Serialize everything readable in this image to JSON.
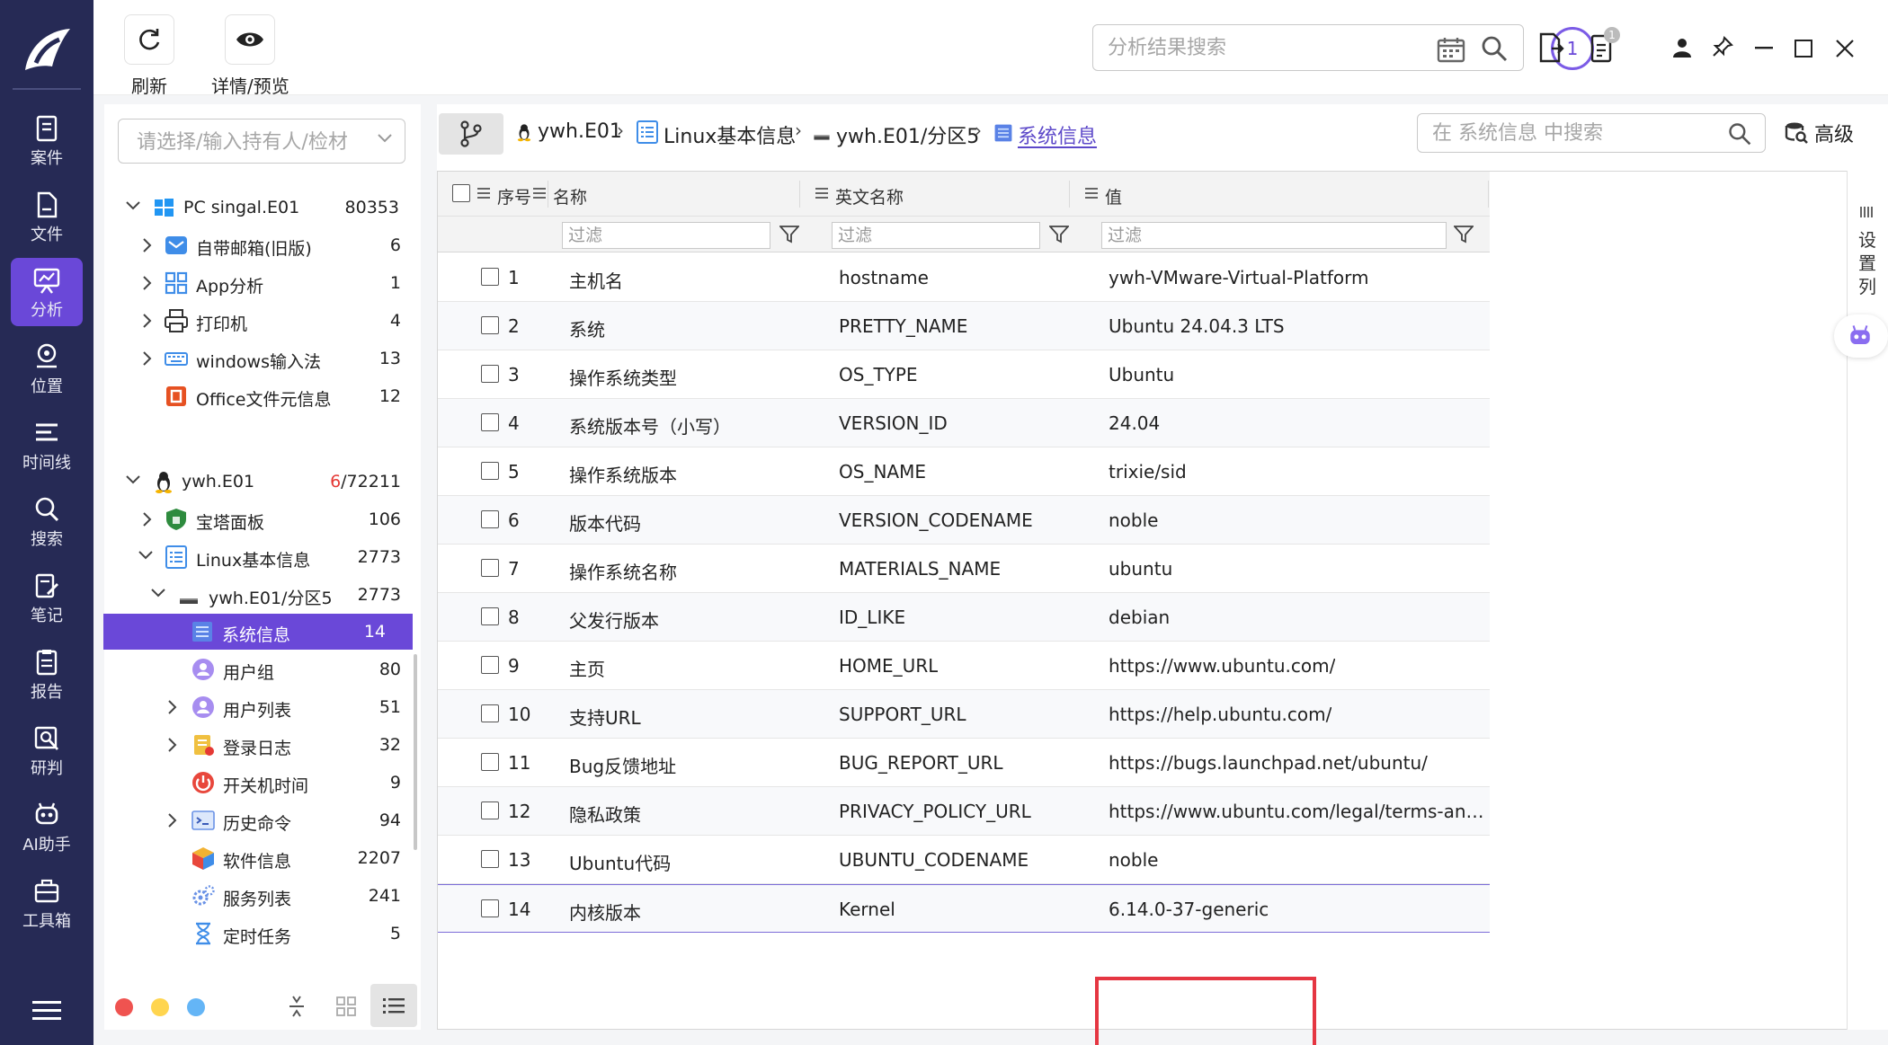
{
  "nav": {
    "items": [
      {
        "label": "案件",
        "icon": "case-icon"
      },
      {
        "label": "文件",
        "icon": "file-icon"
      },
      {
        "label": "分析",
        "icon": "analysis-icon"
      },
      {
        "label": "位置",
        "icon": "location-icon"
      },
      {
        "label": "时间线",
        "icon": "timeline-icon"
      },
      {
        "label": "搜索",
        "icon": "search-icon"
      },
      {
        "label": "笔记",
        "icon": "note-icon"
      },
      {
        "label": "报告",
        "icon": "report-icon"
      },
      {
        "label": "研判",
        "icon": "judge-icon"
      },
      {
        "label": "AI助手",
        "icon": "ai-robot-icon"
      },
      {
        "label": "工具箱",
        "icon": "toolbox-icon"
      }
    ],
    "active": "分析"
  },
  "toolbar": {
    "refresh_label": "刷新",
    "preview_label": "详情/预览",
    "search_placeholder": "分析结果搜索",
    "task_count": "1",
    "clipboard_badge": "1"
  },
  "tree": {
    "select_placeholder": "请选择/输入持有人/检材",
    "nodes": [
      {
        "label": "PC singal.E01",
        "count": "80353"
      },
      {
        "label": "自带邮箱(旧版)",
        "count": "6"
      },
      {
        "label": "App分析",
        "count": "1"
      },
      {
        "label": "打印机",
        "count": "4"
      },
      {
        "label": "windows输入法",
        "count": "13"
      },
      {
        "label": "Office文件元信息",
        "count": "12"
      },
      {
        "label": "ywh.E01",
        "count_red": "6",
        "count_rest": "/72211"
      },
      {
        "label": "宝塔面板",
        "count": "106"
      },
      {
        "label": "Linux基本信息",
        "count": "2773"
      },
      {
        "label": "ywh.E01/分区5",
        "count": "2773"
      },
      {
        "label": "系统信息",
        "count": "14"
      },
      {
        "label": "用户组",
        "count": "80"
      },
      {
        "label": "用户列表",
        "count": "51"
      },
      {
        "label": "登录日志",
        "count": "32"
      },
      {
        "label": "开关机时间",
        "count": "9"
      },
      {
        "label": "历史命令",
        "count": "94"
      },
      {
        "label": "软件信息",
        "count": "2207"
      },
      {
        "label": "服务列表",
        "count": "241"
      },
      {
        "label": "定时任务",
        "count": "5"
      }
    ]
  },
  "breadcrumb": {
    "items": [
      "ywh.E01",
      "Linux基本信息",
      "ywh.E01/分区5",
      "系统信息"
    ],
    "search_placeholder": "在 系统信息 中搜索",
    "advanced_label": "高级"
  },
  "table": {
    "headers": [
      "序号",
      "名称",
      "英文名称",
      "值"
    ],
    "filter_placeholder": "过滤",
    "rows": [
      {
        "no": "1",
        "name": "主机名",
        "en": "hostname",
        "value": "ywh-VMware-Virtual-Platform"
      },
      {
        "no": "2",
        "name": "系统",
        "en": "PRETTY_NAME",
        "value": "Ubuntu 24.04.3 LTS"
      },
      {
        "no": "3",
        "name": "操作系统类型",
        "en": "OS_TYPE",
        "value": "Ubuntu"
      },
      {
        "no": "4",
        "name": "系统版本号（小写）",
        "en": "VERSION_ID",
        "value": "24.04"
      },
      {
        "no": "5",
        "name": "操作系统版本",
        "en": "OS_NAME",
        "value": "trixie/sid"
      },
      {
        "no": "6",
        "name": "版本代码",
        "en": "VERSION_CODENAME",
        "value": "noble"
      },
      {
        "no": "7",
        "name": "操作系统名称",
        "en": "MATERIALS_NAME",
        "value": "ubuntu"
      },
      {
        "no": "8",
        "name": "父发行版本",
        "en": "ID_LIKE",
        "value": "debian"
      },
      {
        "no": "9",
        "name": "主页",
        "en": "HOME_URL",
        "value": "https://www.ubuntu.com/"
      },
      {
        "no": "10",
        "name": "支持URL",
        "en": "SUPPORT_URL",
        "value": "https://help.ubuntu.com/"
      },
      {
        "no": "11",
        "name": "Bug反馈地址",
        "en": "BUG_REPORT_URL",
        "value": "https://bugs.launchpad.net/ubuntu/"
      },
      {
        "no": "12",
        "name": "隐私政策",
        "en": "PRIVACY_POLICY_URL",
        "value": "https://www.ubuntu.com/legal/terms-and-..."
      },
      {
        "no": "13",
        "name": "Ubuntu代码",
        "en": "UBUNTU_CODENAME",
        "value": "noble"
      },
      {
        "no": "14",
        "name": "内核版本",
        "en": "Kernel",
        "value": "6.14.0-37-generic"
      }
    ]
  },
  "right_strip": {
    "label": "设置列"
  },
  "colors": {
    "nav_bg": "#262a55",
    "accent": "#6a48d8",
    "highlight": "#e53642"
  }
}
